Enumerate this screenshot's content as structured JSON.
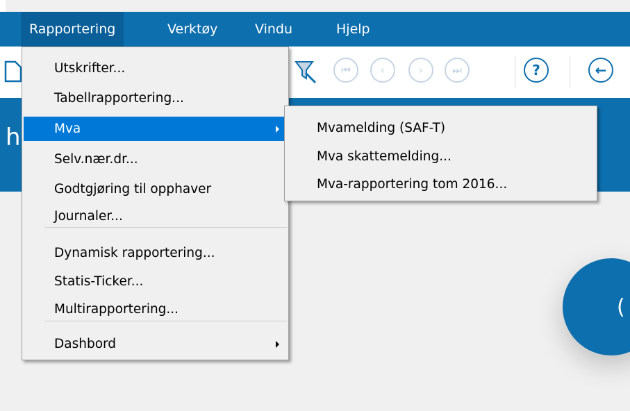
{
  "menubar": {
    "items": [
      {
        "label": "Rapportering",
        "active": true
      },
      {
        "label": "Verktøy",
        "active": false
      },
      {
        "label": "Vindu",
        "active": false
      },
      {
        "label": "Hjelp",
        "active": false
      }
    ]
  },
  "toolbar": {
    "icons": [
      "new-document-icon",
      "clear-filter-icon",
      "first-record-icon",
      "previous-record-icon",
      "next-record-icon",
      "last-record-icon",
      "help-search-icon",
      "back-icon"
    ],
    "glyphs": {
      "first": "⏮",
      "previous": "‹",
      "next": "›",
      "last": "⏭",
      "help": "?",
      "back": "←"
    }
  },
  "banner": {
    "partial_text": "h"
  },
  "tile": {
    "partial_text": "("
  },
  "rapportering_menu": {
    "items": [
      {
        "label": "Utskrifter...",
        "accelerator": "U"
      },
      {
        "label": "Tabellrapportering...",
        "accelerator": "T"
      },
      {
        "label": "Mva",
        "accelerator": "M",
        "has_submenu": true,
        "highlighted": true
      },
      {
        "label": "Selv.nær.dr...",
        "accelerator": "v"
      },
      {
        "label": "Godtgjøring til opphaver",
        "accelerator": "G"
      },
      {
        "label": "Journaler...",
        "accelerator": "J"
      },
      {
        "label": "Dynamisk rapportering...",
        "accelerator": "D"
      },
      {
        "label": "Statis-Ticker...",
        "accelerator": "S"
      },
      {
        "label": "Multirapportering...",
        "accelerator": "l"
      },
      {
        "label": "Dashbord",
        "accelerator": "b",
        "has_submenu": true
      }
    ]
  },
  "mva_submenu": {
    "items": [
      {
        "label": "Mvamelding (SAF-T)",
        "accelerator": "F"
      },
      {
        "label": "Mva skattemelding...",
        "accelerator": "k"
      },
      {
        "label": "Mva-rapportering tom 2016...",
        "accelerator": "M"
      }
    ]
  },
  "colors": {
    "brand_blue": "#0e6fae",
    "menu_highlight": "#0078d7",
    "menu_bg": "#f0f0f0"
  }
}
